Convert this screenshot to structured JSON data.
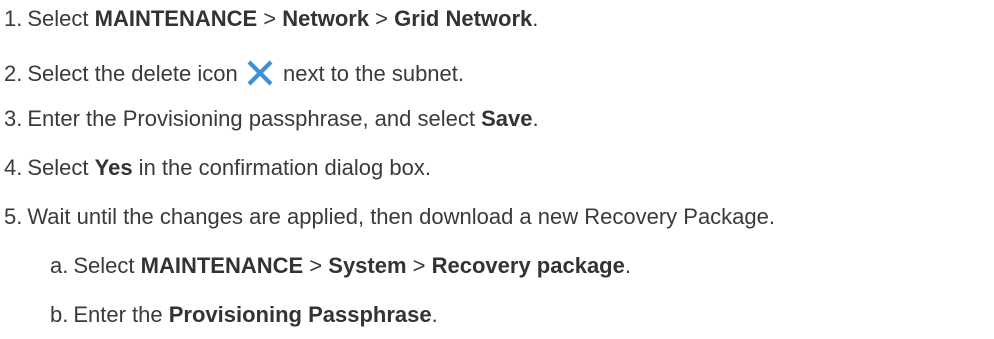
{
  "steps": [
    {
      "number": "1.",
      "parts": [
        "Select ",
        "MAINTENANCE",
        " > ",
        "Network",
        " > ",
        "Grid Network",
        "."
      ]
    },
    {
      "number": "2.",
      "before_icon": "Select the delete icon",
      "icon": "delete-x-icon",
      "after_icon": "next to the subnet."
    },
    {
      "number": "3.",
      "parts": [
        "Enter the Provisioning passphrase, and select ",
        "Save",
        "."
      ]
    },
    {
      "number": "4.",
      "parts": [
        "Select ",
        "Yes",
        " in the confirmation dialog box."
      ]
    },
    {
      "number": "5.",
      "text": "Wait until the changes are applied, then download a new Recovery Package.",
      "substeps": [
        {
          "letter": "a.",
          "parts": [
            "Select ",
            "MAINTENANCE",
            " > ",
            "System",
            " > ",
            "Recovery package",
            "."
          ]
        },
        {
          "letter": "b.",
          "parts": [
            "Enter the ",
            "Provisioning Passphrase",
            "."
          ]
        }
      ]
    }
  ],
  "colors": {
    "text": "#3a3a3a",
    "icon": "#3d8fd6"
  }
}
